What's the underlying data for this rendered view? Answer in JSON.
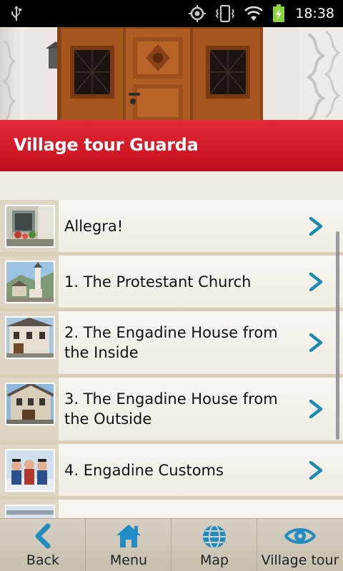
{
  "status_bar": {
    "time": "18:38",
    "icons": [
      "usb-icon",
      "gps-icon",
      "vibrate-icon",
      "wifi-icon",
      "battery-charging-icon"
    ]
  },
  "header": {
    "title": "Village tour Guarda",
    "image": "wooden-door-photo"
  },
  "list": {
    "items": [
      {
        "label": "Allegra!",
        "thumbnail": "window-flowers-photo",
        "icon": "chevron-right-icon"
      },
      {
        "label": "1. The Protestant Church",
        "thumbnail": "church-photo",
        "icon": "chevron-right-icon"
      },
      {
        "label": "2. The Engadine House from the Inside",
        "thumbnail": "engadine-house-photo",
        "icon": "chevron-right-icon"
      },
      {
        "label": "3. The Engadine House from the Outside",
        "thumbnail": "engadine-house-outside-photo",
        "icon": "chevron-right-icon"
      },
      {
        "label": "4. Engadine Customs",
        "thumbnail": "customs-photo",
        "icon": "chevron-right-icon"
      }
    ]
  },
  "nav": {
    "items": [
      {
        "label": "Back",
        "icon": "back-arrow-icon"
      },
      {
        "label": "Menu",
        "icon": "home-icon"
      },
      {
        "label": "Map",
        "icon": "globe-icon"
      },
      {
        "label": "Village tour",
        "icon": "eye-icon"
      }
    ]
  },
  "colors": {
    "banner_red": "#d01a26",
    "chevron_blue": "#1a8ab0",
    "nav_icon_blue": "#1f8dc4"
  }
}
